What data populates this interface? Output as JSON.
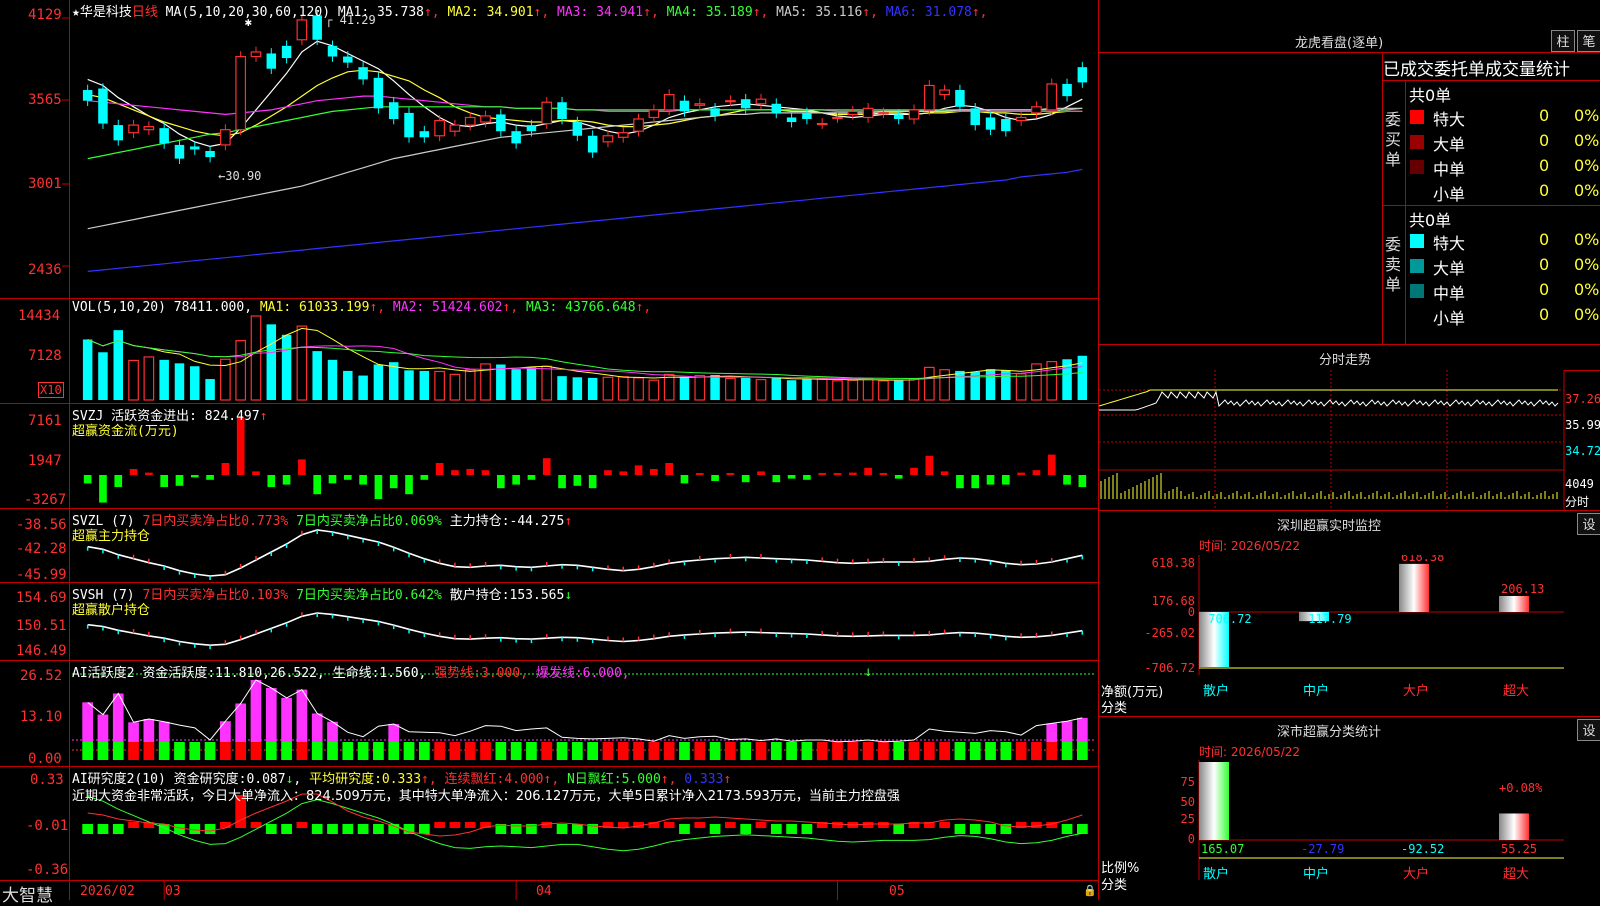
{
  "header": {
    "title": "★华是科技",
    "period": "日线",
    "ma_label": "MA(5,10,20,30,60,120)",
    "ma_values": [
      {
        "name": "MA1",
        "value": "35.738",
        "arrow": "↑",
        "color": "#ffffff"
      },
      {
        "name": "MA2",
        "value": "34.901",
        "arrow": "↑",
        "color": "#ffff33"
      },
      {
        "name": "MA3",
        "value": "34.941",
        "arrow": "↑",
        "color": "#ff33ff"
      },
      {
        "name": "MA4",
        "value": "35.189",
        "arrow": "↑",
        "color": "#33ff33"
      },
      {
        "name": "MA5",
        "value": "35.116",
        "arrow": "↑",
        "color": "#cccccc"
      },
      {
        "name": "MA6",
        "value": "31.078",
        "arrow": "↑",
        "color": "#3333ff"
      }
    ]
  },
  "price_axis": [
    "4129",
    "3565",
    "3001",
    "2436"
  ],
  "price_annotations": {
    "high": "41.29",
    "low": "30.90"
  },
  "volume": {
    "label": "VOL(5,10,20)",
    "value": "78411.000",
    "ma": [
      {
        "name": "MA1",
        "value": "61033.199",
        "arrow": "↑",
        "color": "#ffff33"
      },
      {
        "name": "MA2",
        "value": "51424.602",
        "arrow": "↑",
        "color": "#ff33ff"
      },
      {
        "name": "MA3",
        "value": "43766.648",
        "arrow": "↑",
        "color": "#33ff33"
      }
    ],
    "axis": [
      "14434",
      "7128"
    ],
    "unit": "X10"
  },
  "svzj": {
    "label": "SVZJ",
    "item": "活跃资金进出:",
    "value": "824.497",
    "arrow": "↑",
    "sub": "超赢资金流(万元)",
    "axis": [
      "7161",
      "1947",
      "-3267"
    ]
  },
  "svzl": {
    "label": "SVZL (7)",
    "a": "7日内买卖净占比0.773%",
    "b": "7日内买卖净占比0.069%",
    "c": "主力持仓:",
    "c_value": "-44.275",
    "arrow": "↑",
    "sub": "超赢主力持仓",
    "axis": [
      "-38.56",
      "-42.28",
      "-45.99"
    ]
  },
  "svsh": {
    "label": "SVSH (7)",
    "a": "7日内买卖净占比0.103%",
    "b": "7日内买卖净占比0.642%",
    "c": "散户持仓:",
    "c_value": "153.565",
    "arrow": "↓",
    "sub": "超赢散户持仓",
    "axis": [
      "154.69",
      "150.51",
      "146.49"
    ]
  },
  "ai1": {
    "label": "AI活跃度2",
    "a": "资金活跃度:",
    "a_value": "11.810",
    "b_value": "26.522",
    "c": "生命线:",
    "c_value": "1.560",
    "d": "强势线:",
    "d_value": "3.000",
    "e": "爆发线:",
    "e_value": "6.000",
    "axis": [
      "26.52",
      "13.10",
      "0.00"
    ]
  },
  "ai2": {
    "label": "AI研究度2(10)",
    "a": "资金研究度:",
    "a_value": "0.087",
    "a_arrow": "↓",
    "b": "平均研究度:",
    "b_value": "0.333",
    "c": "连续飘红:",
    "c_value": "4.000",
    "d": "N日飘红:",
    "d_value": "5.000",
    "e_value": "0.333",
    "comment": "近期大资金非常活跃，今日大单净流入：824.509万元，其中特大单净流入：206.127万元，大单5日累计净入2173.593万元，当前主力控盘强",
    "axis": [
      "0.33",
      "-0.01",
      "-0.36"
    ]
  },
  "footer": {
    "brand": "大智慧",
    "dates": [
      "2026/02",
      "03",
      "04",
      "05"
    ]
  },
  "right": {
    "lhb": {
      "title": "龙虎看盘(逐单)",
      "btn1": "柱",
      "btn2": "笔",
      "header": "已成交委托单成交量统计",
      "buy": {
        "side": "委买单",
        "total": "共0单",
        "rows": [
          {
            "name": "特大",
            "value": "0",
            "pct": "0%",
            "color": "#ff0000"
          },
          {
            "name": "大单",
            "value": "0",
            "pct": "0%",
            "color": "#990000"
          },
          {
            "name": "中单",
            "value": "0",
            "pct": "0%",
            "color": "#660000"
          },
          {
            "name": "小单",
            "value": "0",
            "pct": "0%",
            "color": "#000000"
          }
        ]
      },
      "sell": {
        "side": "委卖单",
        "total": "共0单",
        "rows": [
          {
            "name": "特大",
            "value": "0",
            "pct": "0%",
            "color": "#00ffff"
          },
          {
            "name": "大单",
            "value": "0",
            "pct": "0%",
            "color": "#009999"
          },
          {
            "name": "中单",
            "value": "0",
            "pct": "0%",
            "color": "#007777"
          },
          {
            "name": "小单",
            "value": "0",
            "pct": "0%",
            "color": "#000000"
          }
        ]
      }
    },
    "intraday": {
      "title": "分时走势",
      "axis": [
        "37.26",
        "35.99",
        "34.72"
      ],
      "vol_axis": [
        "4049",
        "分时"
      ]
    },
    "monitor": {
      "title": "深圳超赢实时监控",
      "btn": "设",
      "time": "时间: 2026/05/22",
      "axis": [
        "618.38",
        "176.68",
        "0",
        "-265.02",
        "-706.72"
      ],
      "unit_a": "净额(万元)",
      "unit_b": "分类",
      "categories": [
        "散户",
        "中户",
        "大户",
        "超大"
      ],
      "values": [
        -706.72,
        -117.79,
        618.38,
        206.13
      ],
      "labels": [
        "-706.72",
        "-117.79",
        "618.38",
        "206.13"
      ]
    },
    "stats": {
      "title": "深市超赢分类统计",
      "btn": "设",
      "time": "时间: 2026/05/22",
      "axis": [
        "75",
        "50",
        "25",
        "0"
      ],
      "unit_a": "比例%",
      "unit_b": "分类",
      "categories": [
        "散户",
        "中户",
        "大户",
        "超大"
      ],
      "values": [
        165.07,
        -27.79,
        -92.52,
        55.25
      ],
      "labels": [
        "165.07",
        "-27.79",
        "-92.52",
        "55.25"
      ],
      "top_label": "+0.08%"
    }
  },
  "chart_data": {
    "type": "candlestick",
    "title": "华是科技 日线",
    "ylim": [
      24.36,
      41.29
    ],
    "open": [
      36.3,
      36.4,
      34.0,
      33.5,
      33.7,
      33.8,
      32.7,
      32.6,
      32.3,
      32.7,
      33.7,
      38.5,
      38.7,
      39.2,
      39.6,
      41.2,
      39.2,
      38.5,
      37.8,
      37.1,
      35.5,
      34.8,
      33.6,
      33.3,
      33.6,
      34.0,
      34.2,
      34.7,
      33.6,
      34.0,
      34.1,
      35.5,
      34.2,
      33.3,
      32.9,
      33.2,
      33.6,
      34.5,
      35.0,
      35.6,
      35.3,
      35.1,
      35.6,
      35.7,
      35.4,
      35.4,
      34.5,
      34.8,
      34.1,
      34.5,
      34.7,
      34.5,
      34.8,
      34.7,
      34.4,
      35.0,
      36.0,
      36.3,
      35.1,
      34.5,
      34.4,
      34.3,
      34.8,
      35.0,
      36.7,
      37.8
    ],
    "close": [
      35.6,
      34.1,
      33.0,
      34.0,
      33.9,
      32.8,
      31.8,
      32.4,
      31.9,
      33.7,
      38.5,
      38.8,
      37.7,
      38.4,
      40.9,
      39.6,
      38.5,
      38.1,
      37.0,
      35.1,
      34.4,
      33.2,
      33.2,
      34.3,
      34.0,
      34.5,
      34.6,
      33.6,
      32.8,
      33.6,
      35.5,
      34.4,
      33.3,
      32.2,
      33.3,
      33.5,
      34.4,
      35.0,
      36.0,
      34.9,
      35.4,
      34.6,
      35.6,
      35.1,
      35.7,
      34.8,
      34.2,
      34.4,
      34.1,
      34.5,
      34.9,
      35.1,
      34.8,
      34.4,
      35.0,
      36.6,
      36.3,
      35.2,
      34.0,
      33.7,
      33.6,
      34.5,
      35.2,
      36.7,
      35.9,
      36.8
    ],
    "volume": [
      10400,
      8200,
      12000,
      6800,
      7400,
      6900,
      6300,
      5800,
      3600,
      7000,
      10200,
      14434,
      13000,
      11200,
      12700,
      8400,
      6900,
      5000,
      4200,
      6100,
      6500,
      5100,
      5000,
      4900,
      4400,
      5200,
      6200,
      6100,
      5300,
      5600,
      5800,
      4100,
      3900,
      3800,
      3900,
      4000,
      3800,
      3400,
      4400,
      3900,
      4200,
      4300,
      3700,
      3800,
      3500,
      3800,
      3400,
      3600,
      3600,
      3300,
      3400,
      3600,
      3300,
      3400,
      3600,
      5600,
      5200,
      5000,
      4800,
      5300,
      5100,
      4500,
      6200,
      6600,
      7000,
      7600
    ],
    "series": [
      {
        "name": "MA1",
        "color": "#ffffff",
        "values": [
          37.0,
          36.6,
          35.8,
          35.2,
          34.6,
          34.1,
          33.4,
          32.9,
          32.6,
          32.8,
          33.8,
          35.0,
          36.2,
          37.4,
          38.8,
          39.5,
          39.2,
          38.7,
          38.2,
          37.7,
          36.9,
          36.0,
          35.2,
          34.5,
          34.0,
          33.9,
          34.1,
          34.2,
          34.0,
          33.9,
          34.1,
          34.3,
          34.2,
          33.9,
          33.6,
          33.4,
          33.6,
          34.0,
          34.5,
          34.8,
          35.0,
          35.2,
          35.3,
          35.4,
          35.3,
          35.2,
          35.1,
          35.0,
          34.8,
          34.6,
          34.5,
          34.6,
          34.7,
          34.7,
          34.7,
          34.8,
          35.1,
          35.3,
          35.2,
          34.9,
          34.5,
          34.3,
          34.4,
          34.7,
          35.2,
          35.7
        ]
      },
      {
        "name": "MA2",
        "color": "#ffff33",
        "values": [
          36.0,
          35.8,
          35.4,
          35.0,
          34.6,
          34.2,
          33.9,
          33.6,
          33.4,
          33.3,
          33.5,
          34.0,
          34.6,
          35.2,
          35.9,
          36.6,
          37.1,
          37.5,
          37.6,
          37.5,
          37.2,
          36.9,
          36.3,
          35.8,
          35.2,
          34.8,
          34.5,
          34.4,
          34.3,
          34.2,
          34.2,
          34.3,
          34.3,
          34.2,
          34.0,
          33.9,
          33.9,
          34.0,
          34.1,
          34.3,
          34.5,
          34.6,
          34.8,
          35.0,
          35.0,
          35.0,
          34.9,
          34.9,
          34.8,
          34.7,
          34.7,
          34.7,
          34.8,
          34.8,
          34.7,
          34.8,
          34.8,
          34.9,
          34.9,
          34.8,
          34.8,
          34.7,
          34.7,
          34.8,
          34.9,
          34.9
        ]
      },
      {
        "name": "MA3",
        "color": "#ff33ff",
        "values": [
          35.6,
          35.5,
          35.4,
          35.3,
          35.2,
          35.1,
          35.0,
          34.9,
          34.8,
          34.7,
          34.8,
          34.9,
          35.0,
          35.2,
          35.4,
          35.6,
          35.7,
          35.8,
          35.9,
          35.9,
          35.8,
          35.7,
          35.6,
          35.5,
          35.4,
          35.3,
          35.2,
          35.2,
          35.1,
          35.1,
          35.1,
          35.1,
          35.0,
          35.0,
          34.9,
          34.9,
          34.9,
          34.9,
          34.9,
          35.0,
          35.0,
          35.0,
          35.0,
          35.0,
          35.0,
          35.0,
          35.0,
          35.0,
          35.0,
          34.9,
          34.9,
          34.9,
          34.9,
          34.9,
          34.9,
          34.9,
          34.9,
          34.9,
          34.9,
          34.9,
          34.9,
          34.9,
          34.9,
          34.9,
          34.9,
          34.9
        ]
      },
      {
        "name": "MA4",
        "color": "#33ff33",
        "values": [
          31.8,
          32.0,
          32.2,
          32.4,
          32.6,
          32.8,
          33.0,
          33.2,
          33.4,
          33.5,
          33.7,
          33.9,
          34.1,
          34.3,
          34.5,
          34.7,
          34.9,
          35.0,
          35.1,
          35.2,
          35.2,
          35.2,
          35.2,
          35.2,
          35.2,
          35.2,
          35.2,
          35.2,
          35.1,
          35.1,
          35.1,
          35.1,
          35.0,
          35.0,
          35.0,
          35.0,
          35.0,
          35.0,
          35.0,
          35.0,
          35.0,
          35.0,
          35.0,
          35.0,
          35.0,
          35.0,
          35.0,
          35.0,
          35.0,
          35.0,
          35.0,
          35.0,
          35.0,
          35.0,
          35.0,
          35.0,
          35.0,
          35.0,
          35.0,
          35.0,
          35.0,
          35.0,
          35.0,
          35.0,
          35.0,
          35.1
        ]
      },
      {
        "name": "MA5",
        "color": "#cccccc",
        "values": [
          27.2,
          27.4,
          27.6,
          27.8,
          28.0,
          28.2,
          28.4,
          28.6,
          28.8,
          29.0,
          29.2,
          29.4,
          29.6,
          29.8,
          30.0,
          30.3,
          30.6,
          30.9,
          31.2,
          31.5,
          31.8,
          32.0,
          32.2,
          32.4,
          32.6,
          32.8,
          33.0,
          33.2,
          33.3,
          33.4,
          33.5,
          33.6,
          33.7,
          33.8,
          33.9,
          34.0,
          34.1,
          34.2,
          34.3,
          34.4,
          34.5,
          34.6,
          34.7,
          34.7,
          34.8,
          34.8,
          34.8,
          34.8,
          34.8,
          34.8,
          34.8,
          34.8,
          34.9,
          34.9,
          34.9,
          34.9,
          34.9,
          35.0,
          35.0,
          35.0,
          35.0,
          35.0,
          35.0,
          35.1,
          35.1,
          35.1
        ]
      },
      {
        "name": "MA6",
        "color": "#3333ff",
        "values": [
          24.4,
          24.5,
          24.6,
          24.7,
          24.8,
          24.9,
          25.0,
          25.1,
          25.2,
          25.3,
          25.4,
          25.5,
          25.6,
          25.7,
          25.8,
          25.9,
          26.0,
          26.1,
          26.2,
          26.3,
          26.4,
          26.5,
          26.6,
          26.7,
          26.8,
          26.9,
          27.0,
          27.1,
          27.2,
          27.3,
          27.4,
          27.5,
          27.6,
          27.7,
          27.8,
          27.9,
          28.0,
          28.1,
          28.2,
          28.3,
          28.4,
          28.5,
          28.6,
          28.7,
          28.8,
          28.9,
          29.0,
          29.1,
          29.2,
          29.3,
          29.4,
          29.5,
          29.6,
          29.7,
          29.8,
          29.9,
          30.0,
          30.1,
          30.2,
          30.3,
          30.4,
          30.6,
          30.7,
          30.8,
          30.9,
          31.1
        ]
      }
    ]
  }
}
